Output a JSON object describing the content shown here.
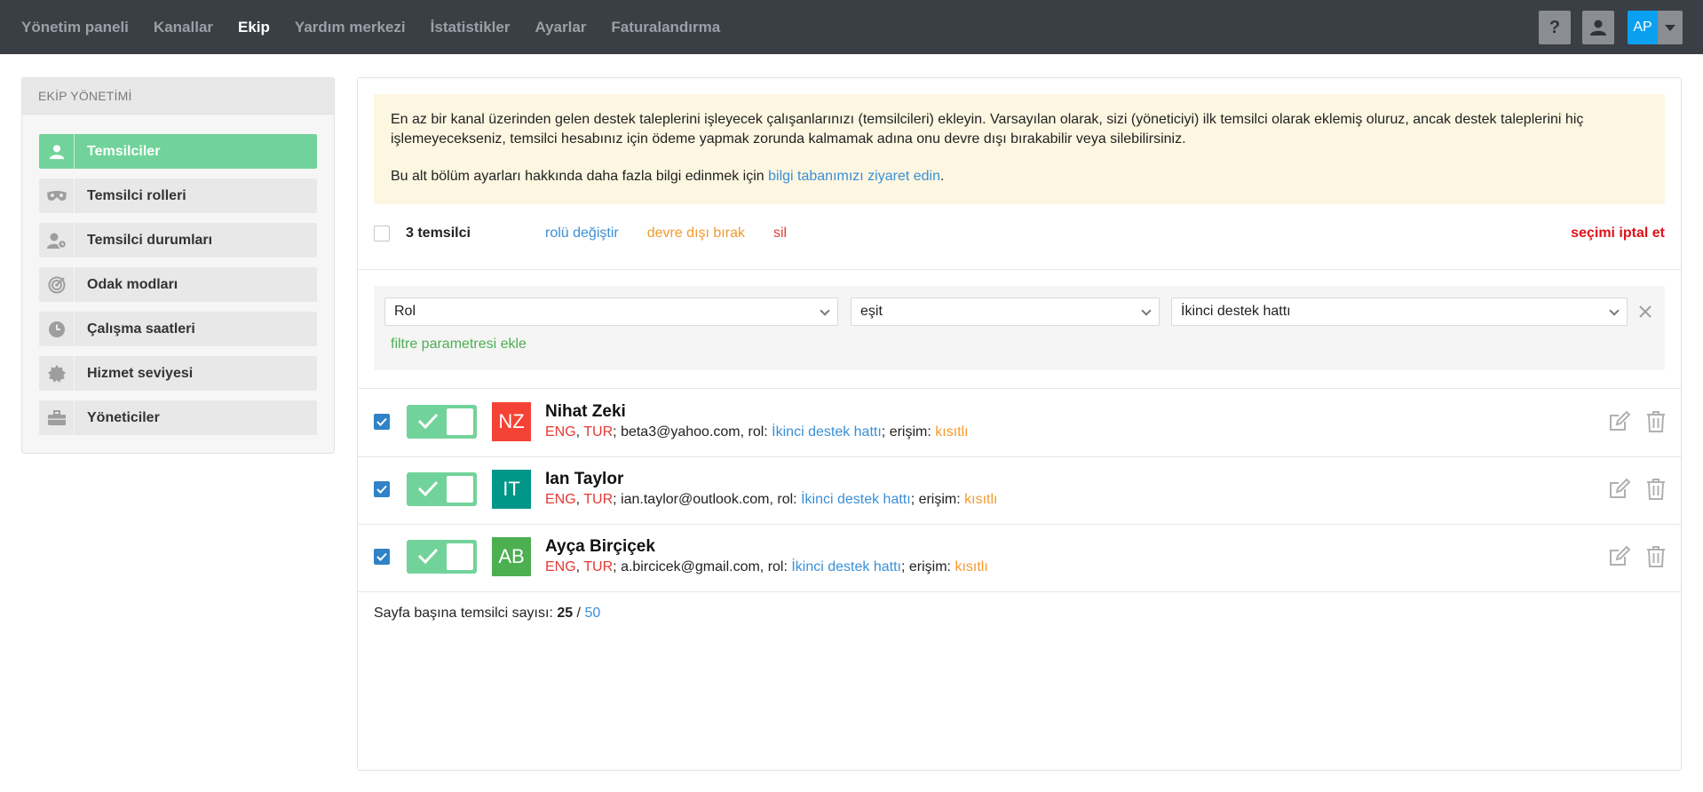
{
  "nav": {
    "items": [
      {
        "label": "Yönetim paneli",
        "active": false
      },
      {
        "label": "Kanallar",
        "active": false
      },
      {
        "label": "Ekip",
        "active": true
      },
      {
        "label": "Yardım merkezi",
        "active": false
      },
      {
        "label": "İstatistikler",
        "active": false
      },
      {
        "label": "Ayarlar",
        "active": false
      },
      {
        "label": "Faturalandırma",
        "active": false
      }
    ],
    "help_label": "?",
    "avatar_initials": "AP"
  },
  "sidebar": {
    "heading": "EKİP YÖNETİMİ",
    "items": [
      {
        "label": "Temsilciler",
        "icon": "user-icon",
        "active": true
      },
      {
        "label": "Temsilci rolleri",
        "icon": "mask-icon",
        "active": false
      },
      {
        "label": "Temsilci durumları",
        "icon": "user-status-icon",
        "active": false
      },
      {
        "label": "Odak modları",
        "icon": "target-icon",
        "active": false
      },
      {
        "label": "Çalışma saatleri",
        "icon": "clock-icon",
        "active": false
      },
      {
        "label": "Hizmet seviyesi",
        "icon": "badge-icon",
        "active": false
      },
      {
        "label": "Yöneticiler",
        "icon": "briefcase-icon",
        "active": false
      }
    ]
  },
  "notice": {
    "paragraph1": "En az bir kanal üzerinden gelen destek taleplerini işleyecek çalışanlarınızı (temsilcileri) ekleyin. Varsayılan olarak, sizi (yöneticiyi) ilk temsilci olarak eklemiş oluruz, ancak destek taleplerini hiç işlemeyecekseniz, temsilci hesabınız için ödeme yapmak zorunda kalmamak adına onu devre dışı bırakabilir veya silebilirsiniz.",
    "paragraph2_prefix": "Bu alt bölüm ayarları hakkında daha fazla bilgi edinmek için ",
    "paragraph2_link": "bilgi tabanımızı ziyaret edin",
    "paragraph2_suffix": "."
  },
  "bulk": {
    "count": "3 temsilci",
    "change_role": "rolü değiştir",
    "deactivate": "devre dışı bırak",
    "delete": "sil",
    "deselect": "seçimi iptal et"
  },
  "filter": {
    "field": "Rol",
    "operator": "eşit",
    "value": "İkinci destek hattı",
    "add_param": "filtre parametresi ekle"
  },
  "agents": [
    {
      "initials": "NZ",
      "color": "#f44336",
      "name": "Nihat Zeki",
      "lang1": "ENG",
      "lang2": "TUR",
      "email": "beta3@yahoo.com",
      "role_prefix": ", rol: ",
      "role": "İkinci destek hattı",
      "access_prefix": "; erişim: ",
      "access": "kısıtlı"
    },
    {
      "initials": "IT",
      "color": "#009688",
      "name": "Ian Taylor",
      "lang1": "ENG",
      "lang2": "TUR",
      "email": "ian.taylor@outlook.com",
      "role_prefix": ", rol: ",
      "role": "İkinci destek hattı",
      "access_prefix": "; erişim: ",
      "access": "kısıtlı"
    },
    {
      "initials": "AB",
      "color": "#4caf50",
      "name": "Ayça Birçiçek",
      "lang1": "ENG",
      "lang2": "TUR",
      "email": "a.bircicek@gmail.com",
      "role_prefix": ", rol: ",
      "role": "İkinci destek hattı",
      "access_prefix": "; erişim: ",
      "access": "kısıtlı"
    }
  ],
  "perpage": {
    "label": "Sayfa başına temsilci sayısı: ",
    "current": "25",
    "sep": " / ",
    "alt": "50"
  }
}
